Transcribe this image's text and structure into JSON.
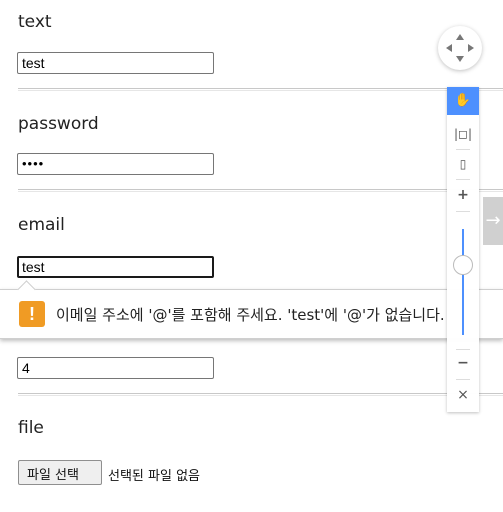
{
  "fields": {
    "text": {
      "label": "text",
      "value": "test"
    },
    "password": {
      "label": "password",
      "value": "••••"
    },
    "email": {
      "label": "email",
      "value": "test"
    },
    "number": {
      "value": "4"
    },
    "file": {
      "label": "file",
      "button_label": "파일 선택",
      "status_text": "선택된 파일 없음"
    }
  },
  "validation": {
    "icon_text": "!",
    "message": "이메일 주소에 '@'를 포함해 주세요. 'test'에 '@'가 없습니다."
  },
  "controls": {
    "hand": "✋",
    "fit_width": "|◻|",
    "fit_height": "▯",
    "zoom_in": "+",
    "zoom_out": "−",
    "close": "×",
    "next": "→",
    "zoom_level": 0.5,
    "colors": {
      "active": "#4d90fe",
      "warning": "#f09b24"
    }
  }
}
